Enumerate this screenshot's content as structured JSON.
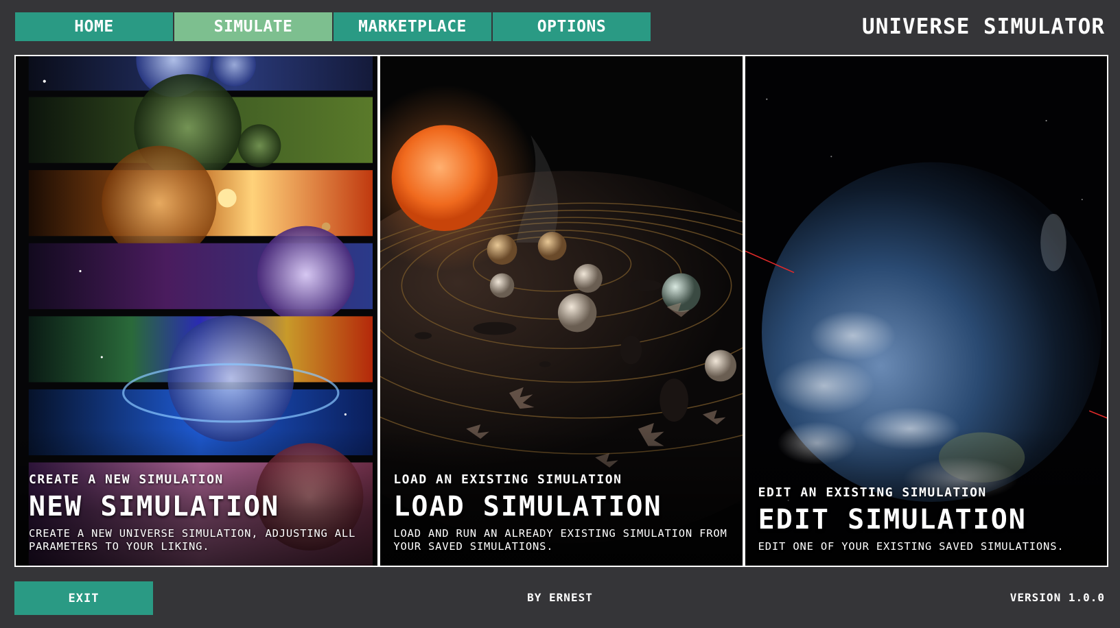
{
  "nav": {
    "tabs": [
      {
        "label": "HOME",
        "active": false
      },
      {
        "label": "SIMULATE",
        "active": true
      },
      {
        "label": "MARKETPLACE",
        "active": false
      },
      {
        "label": "OPTIONS",
        "active": false
      }
    ]
  },
  "app": {
    "title": "UNIVERSE SIMULATOR"
  },
  "cards": [
    {
      "subtitle": "CREATE A NEW SIMULATION",
      "title": "NEW SIMULATION",
      "description": "CREATE A NEW UNIVERSE SIMULATION, ADJUSTING ALL PARAMETERS TO YOUR LIKING."
    },
    {
      "subtitle": "LOAD AN EXISTING SIMULATION",
      "title": "LOAD SIMULATION",
      "description": "LOAD AND RUN AN ALREADY EXISTING SIMULATION FROM YOUR SAVED SIMULATIONS."
    },
    {
      "subtitle": "EDIT AN EXISTING SIMULATION",
      "title": "EDIT SIMULATION",
      "description": "EDIT ONE OF YOUR EXISTING SAVED SIMULATIONS."
    }
  ],
  "footer": {
    "exit_label": "EXIT",
    "credit": "BY ERNEST",
    "version": "VERSION 1.0.0"
  },
  "colors": {
    "background": "#353538",
    "tab": "#2a9a84",
    "tab_active": "#7dbf8f",
    "text": "#ffffff"
  }
}
